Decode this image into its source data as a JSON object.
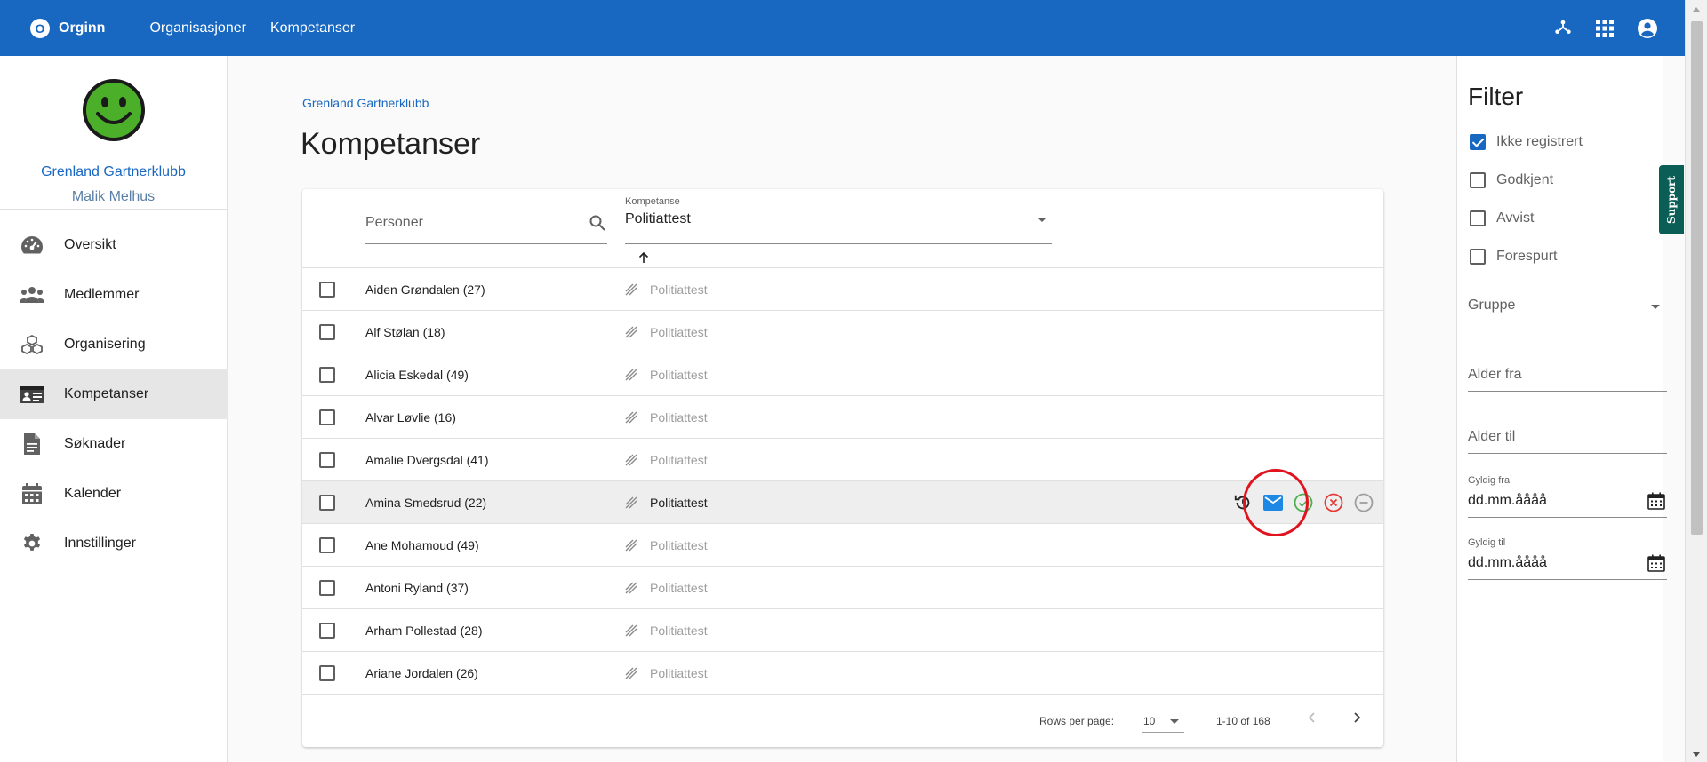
{
  "appbar": {
    "brand_letter": "O",
    "brand_name": "Orginn",
    "nav": [
      "Organisasjoner",
      "Kompetanser"
    ],
    "icons": [
      "hierarchy-icon",
      "apps-grid-icon",
      "account-circle-icon"
    ]
  },
  "sidebar": {
    "org_name": "Grenland Gartnerklubb",
    "user_name": "Malik Melhus",
    "items": [
      {
        "label": "Oversikt",
        "icon": "speedometer-icon"
      },
      {
        "label": "Medlemmer",
        "icon": "people-icon"
      },
      {
        "label": "Organisering",
        "icon": "cubes-icon"
      },
      {
        "label": "Kompetanser",
        "icon": "id-card-icon",
        "active": true
      },
      {
        "label": "Søknader",
        "icon": "document-icon"
      },
      {
        "label": "Kalender",
        "icon": "calendar-icon"
      },
      {
        "label": "Innstillinger",
        "icon": "gear-icon"
      }
    ]
  },
  "main": {
    "breadcrumb": "Grenland Gartnerklubb",
    "title": "Kompetanser",
    "search_placeholder": "Personer",
    "select_label": "Kompetanse",
    "select_value": "Politiattest",
    "rows": [
      {
        "name": "Aiden Grøndalen (27)",
        "competence": "Politiattest"
      },
      {
        "name": "Alf Stølan (18)",
        "competence": "Politiattest"
      },
      {
        "name": "Alicia Eskedal (49)",
        "competence": "Politiattest"
      },
      {
        "name": "Alvar Løvlie (16)",
        "competence": "Politiattest"
      },
      {
        "name": "Amalie Dvergsdal (41)",
        "competence": "Politiattest"
      },
      {
        "name": "Amina Smedsrud (22)",
        "competence": "Politiattest",
        "hover": true
      },
      {
        "name": "Ane Mohamoud (49)",
        "competence": "Politiattest"
      },
      {
        "name": "Antoni Ryland (37)",
        "competence": "Politiattest"
      },
      {
        "name": "Arham Pollestad (28)",
        "competence": "Politiattest"
      },
      {
        "name": "Ariane Jordalen (26)",
        "competence": "Politiattest"
      }
    ],
    "footer": {
      "rows_per_page_label": "Rows per page:",
      "rows_per_page_value": "10",
      "range": "1-10 of 168"
    }
  },
  "filter": {
    "title": "Filter",
    "checks": [
      {
        "label": "Ikke registrert",
        "checked": true
      },
      {
        "label": "Godkjent",
        "checked": false
      },
      {
        "label": "Avvist",
        "checked": false
      },
      {
        "label": "Forespurt",
        "checked": false
      }
    ],
    "group_placeholder": "Gruppe",
    "age_from": "Alder fra",
    "age_to": "Alder til",
    "valid_from_label": "Gyldig fra",
    "valid_from_value": "dd.mm.åååå",
    "valid_to_label": "Gyldig til",
    "valid_to_value": "dd.mm.åååå"
  },
  "support": "Support",
  "colors": {
    "primary": "#1867c0",
    "approve": "#4caf50",
    "reject": "#e53935",
    "highlight": "#e0141e",
    "support": "#0b5e55"
  }
}
